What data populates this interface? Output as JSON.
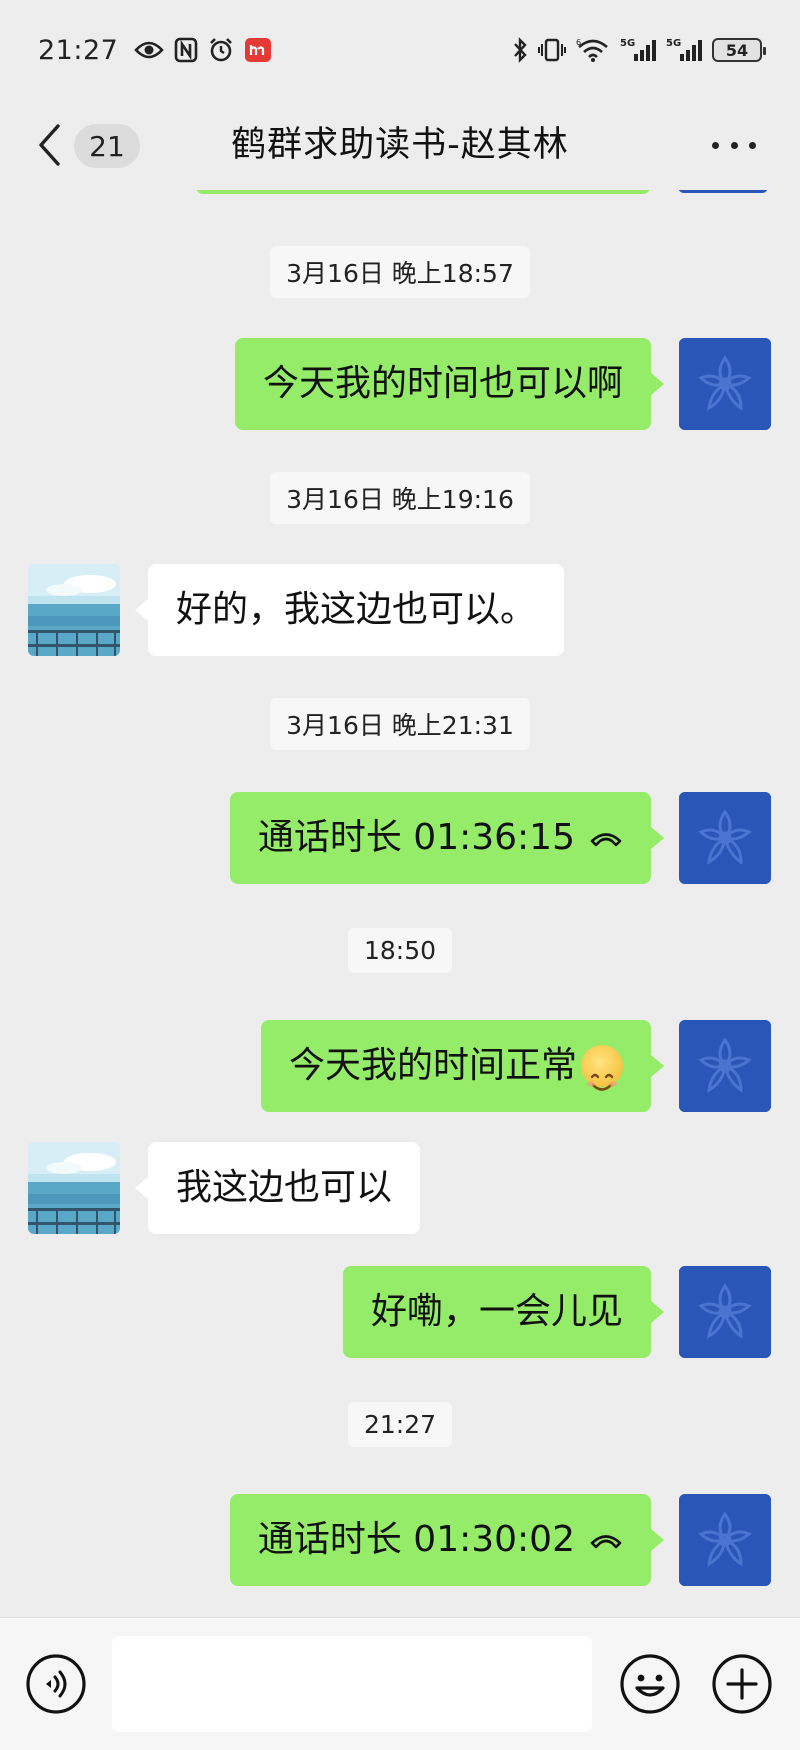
{
  "status_bar": {
    "time": "21:27",
    "battery": "54",
    "icons": [
      "eye-icon",
      "nfc-icon",
      "alarm-icon",
      "app-notification-icon",
      "bluetooth-icon",
      "vibrate-icon",
      "wifi-icon",
      "signal-5g-icon",
      "signal-5g-icon"
    ]
  },
  "header": {
    "unread_count": "21",
    "title": "鹤群求助读书-赵其林",
    "back_icon": "chevron-left-icon",
    "more_icon": "more-dots-icon"
  },
  "messages": {
    "ts1": "3月16日 晚上18:57",
    "m1": "今天我的时间也可以啊",
    "ts2": "3月16日 晚上19:16",
    "m2": "好的，我这边也可以。",
    "ts3": "3月16日 晚上21:31",
    "m3": "通话时长 01:36:15",
    "ts4": "18:50",
    "m4": "今天我的时间正常",
    "m5": "我这边也可以",
    "m6": "好嘞，一会儿见",
    "ts5": "21:27",
    "m7": "通话时长 01:30:02"
  },
  "input_bar": {
    "placeholder": "",
    "voice_icon": "voice-icon",
    "emoji_icon": "smiley-icon",
    "plus_icon": "plus-circle-icon"
  },
  "colors": {
    "background": "#ededed",
    "self_bubble": "#95ec69",
    "other_bubble": "#ffffff",
    "self_avatar": "#2a56b8"
  }
}
